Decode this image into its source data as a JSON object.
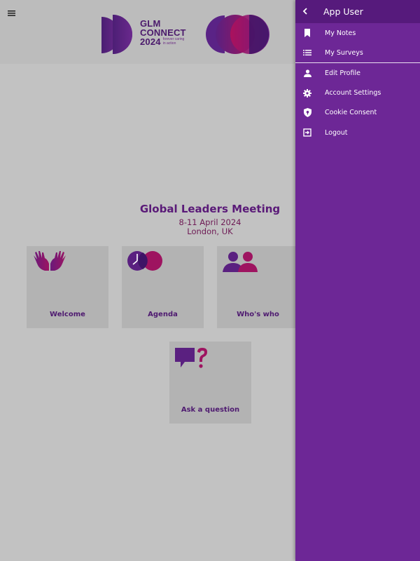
{
  "header": {
    "menu_icon": "hamburger-menu-icon",
    "logo": {
      "line1": "GLM",
      "line2": "CONNECT",
      "year": "2024",
      "tagline_1": "forever caring",
      "tagline_2": "in action"
    }
  },
  "event": {
    "title": "Global Leaders Meeting",
    "dates": "8-11 April 2024",
    "location": "London, UK"
  },
  "tiles": [
    {
      "label": "Welcome",
      "icon": "hands-icon"
    },
    {
      "label": "Agenda",
      "icon": "clock-icon"
    },
    {
      "label": "Who's who",
      "icon": "people-icon"
    },
    {
      "label": "Ask a question",
      "icon": "question-bubble-icon"
    }
  ],
  "drawer": {
    "title": "App User",
    "back_icon": "chevron-left-icon",
    "items": [
      {
        "label": "My Notes",
        "icon": "bookmark-icon"
      },
      {
        "label": "My Surveys",
        "icon": "list-icon"
      },
      {
        "label": "Edit Profile",
        "icon": "person-icon"
      },
      {
        "label": "Account Settings",
        "icon": "gear-icon"
      },
      {
        "label": "Cookie Consent",
        "icon": "shield-lock-icon"
      },
      {
        "label": "Logout",
        "icon": "logout-icon"
      }
    ]
  },
  "colors": {
    "accent_purple": "#6d2796",
    "drawer_header": "#561a7c",
    "title_purple": "#5a1a78",
    "magenta": "#8a1a5a"
  }
}
